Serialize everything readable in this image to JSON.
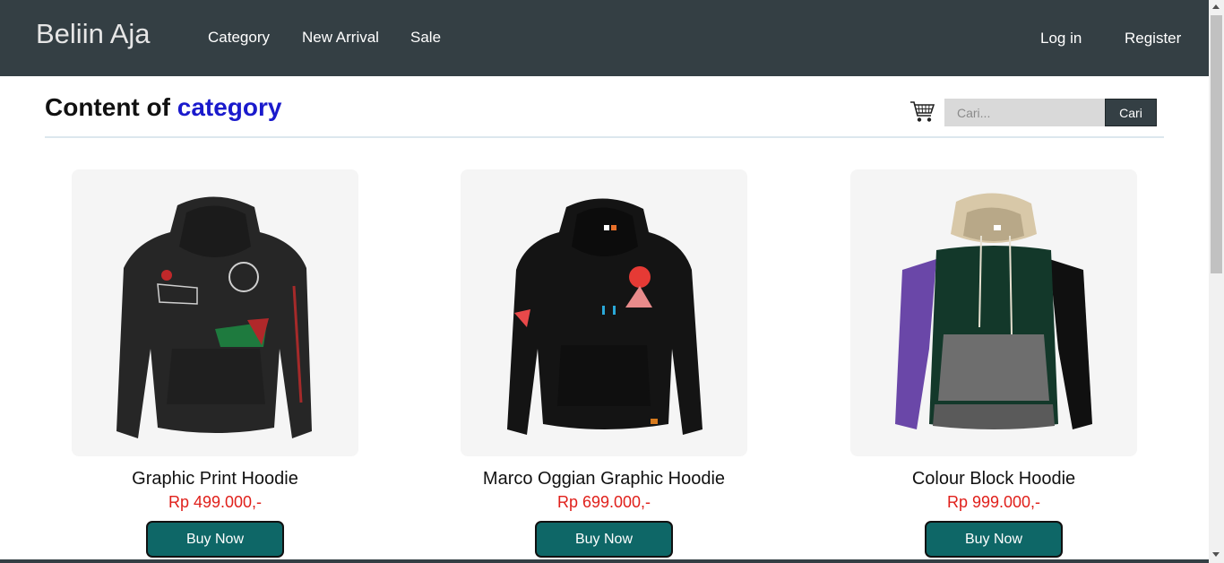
{
  "nav": {
    "brand": "Beliin Aja",
    "links": [
      "Category",
      "New Arrival",
      "Sale"
    ],
    "login": "Log in",
    "register": "Register"
  },
  "heading": {
    "prefix": "Content of",
    "accent": "category"
  },
  "search": {
    "placeholder": "Cari...",
    "button": "Cari"
  },
  "products": [
    {
      "title": "Graphic Print Hoodie",
      "price": "Rp 499.000,-",
      "button": "Buy Now"
    },
    {
      "title": "Marco Oggian Graphic Hoodie",
      "price": "Rp 699.000,-",
      "button": "Buy Now"
    },
    {
      "title": "Colour Block Hoodie",
      "price": "Rp 999.000,-",
      "button": "Buy Now"
    }
  ],
  "colors": {
    "navbar": "#343f44",
    "accent_heading": "#1a1acc",
    "price": "#e0201b",
    "buy_button": "#0e6767"
  }
}
